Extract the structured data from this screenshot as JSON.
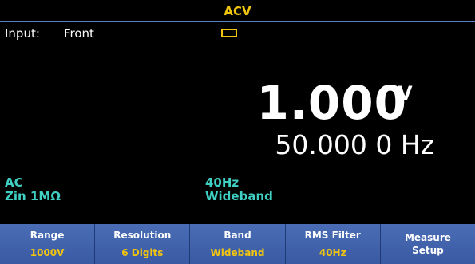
{
  "window": {
    "title": "ACV"
  },
  "status": {
    "input_label": "Input:",
    "input_value": "Front",
    "icon": "battery-icon"
  },
  "measurement": {
    "value": "1.000",
    "unit": "V",
    "frequency": "50.000 0 Hz"
  },
  "info": {
    "coupling": "AC",
    "impedance": "Zin 1MΩ",
    "filter": "40Hz",
    "band": "Wideband"
  },
  "softkeys": [
    {
      "label": "Range",
      "value": "1000V"
    },
    {
      "label": "Resolution",
      "value": "6 Digits"
    },
    {
      "label": "Band",
      "value": "Wideband"
    },
    {
      "label": "RMS Filter",
      "value": "40Hz"
    },
    {
      "label": "Measure\nSetup",
      "value": ""
    }
  ],
  "colors": {
    "title": "#f1c40f",
    "info_text": "#3fd0c3",
    "softkey_bg": "#4a6db5",
    "softkey_value": "#f1c40f"
  }
}
